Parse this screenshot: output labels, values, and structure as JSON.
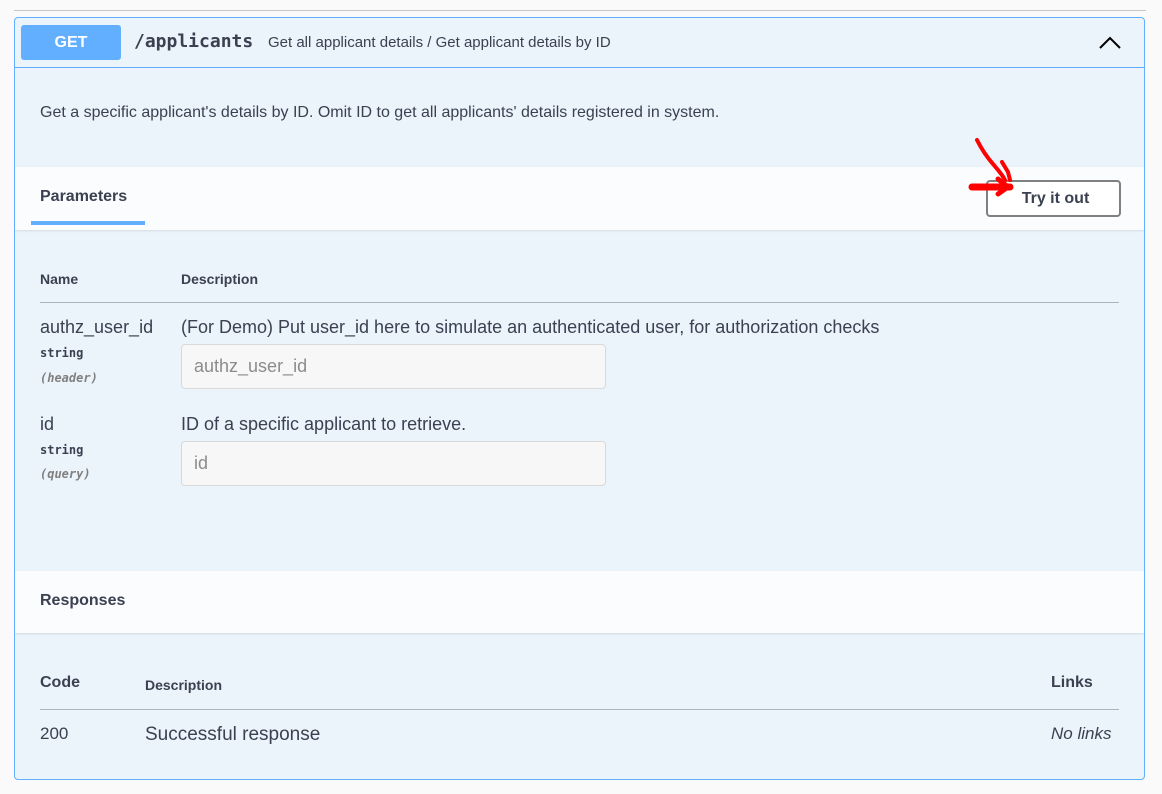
{
  "operation": {
    "method": "GET",
    "path": "/applicants",
    "summary": "Get all applicant details / Get applicant details by ID",
    "description": "Get a specific applicant's details by ID. Omit ID to get all applicants' details registered in system."
  },
  "parameters": {
    "tab_label": "Parameters",
    "try_button_label": "Try it out",
    "columns": {
      "name": "Name",
      "description": "Description"
    },
    "items": [
      {
        "name": "authz_user_id",
        "type": "string",
        "in": "(header)",
        "description": "(For Demo) Put user_id here to simulate an authenticated user, for authorization checks",
        "placeholder": "authz_user_id"
      },
      {
        "name": "id",
        "type": "string",
        "in": "(query)",
        "description": "ID of a specific applicant to retrieve.",
        "placeholder": "id"
      }
    ]
  },
  "responses": {
    "title": "Responses",
    "columns": {
      "code": "Code",
      "description": "Description",
      "links": "Links"
    },
    "rows": [
      {
        "code": "200",
        "description": "Successful response",
        "links": "No links"
      }
    ]
  },
  "colors": {
    "get_accent": "#61affe",
    "block_background": "#ebf3fb",
    "annotation_red": "#ff0000"
  },
  "icons": {
    "collapse": "chevron-up-icon",
    "annotation": "red-arrow-annotation-icon"
  }
}
